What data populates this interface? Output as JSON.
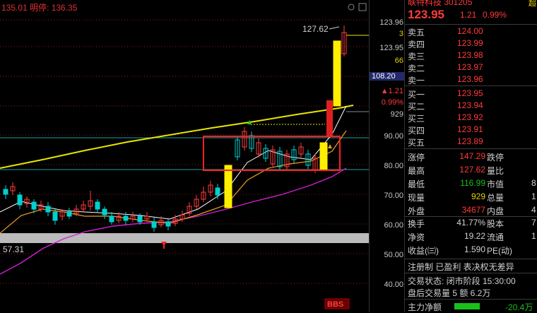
{
  "top_info": {
    "text": "135.01 明停: 136.35"
  },
  "chart": {
    "annotation_high": "127.62",
    "annotation_low": "57.31",
    "bbs_badge": "BBS",
    "colors": {
      "up": "#ff3b3b",
      "down": "#00d0d0",
      "ma_yellow": "#e6e600",
      "ma_white": "#ffffff",
      "ma_magenta": "#d020d0",
      "ma_orange": "#e8a020",
      "band": "#bbbbbb",
      "box": "#ff2020",
      "limit_up": "#ffee00"
    }
  },
  "scale": {
    "top_price": "123.96",
    "s3": "3",
    "s66": "66",
    "s123": "123.95",
    "box_price": "108.20",
    "chg": "▲1.21",
    "pct": "0.99%",
    "vol": "929",
    "ticks": [
      "90.00",
      "80.00",
      "70.00",
      "60.00",
      "50.00",
      "40.00"
    ]
  },
  "panel": {
    "title": "联特科技 301205",
    "corner": "超",
    "price": "123.95",
    "change": "1.21",
    "pct": "0.99%",
    "asks": [
      {
        "label": "卖五",
        "price": "124.00"
      },
      {
        "label": "卖四",
        "price": "123.99"
      },
      {
        "label": "卖三",
        "price": "123.98"
      },
      {
        "label": "卖二",
        "price": "123.97"
      },
      {
        "label": "卖一",
        "price": "123.96"
      }
    ],
    "bids": [
      {
        "label": "买一",
        "price": "123.95"
      },
      {
        "label": "买二",
        "price": "123.94"
      },
      {
        "label": "买三",
        "price": "123.92"
      },
      {
        "label": "买四",
        "price": "123.91"
      },
      {
        "label": "买五",
        "price": "123.89"
      }
    ],
    "stats": [
      {
        "l1": "涨停",
        "v1": "147.29",
        "c1": "red",
        "l2": "跌停"
      },
      {
        "l1": "最高",
        "v1": "127.62",
        "c1": "red",
        "l2": "量比"
      },
      {
        "l1": "最低",
        "v1": "116.99",
        "c1": "green",
        "l2": "市值",
        "v2": "8"
      },
      {
        "l1": "现量",
        "v1": "929",
        "c1": "yel",
        "l2": "总量",
        "v2": "1"
      },
      {
        "l1": "外盘",
        "v1": "34677",
        "c1": "red",
        "l2": "内盘",
        "v2": "4"
      }
    ],
    "stats2": [
      {
        "l1": "换手",
        "v1": "41.77%",
        "c1": "wht",
        "l2": "股本",
        "v2": "7"
      },
      {
        "l1": "净资",
        "v1": "19.22",
        "c1": "wht",
        "l2": "流通",
        "v2": "1"
      },
      {
        "l1": "收益(㈢)",
        "v1": "1.590",
        "c1": "wht",
        "l2": "PE(动)"
      }
    ],
    "reg_line": "注册制  已盈利  表决权无差异",
    "trade_status": "交易状态: 闭市阶段 15:30:00",
    "after_hours": "盘后交易量 5 额 6.2万",
    "main_flow_label": "主力净额",
    "main_flow_value": "-20.4万"
  }
}
